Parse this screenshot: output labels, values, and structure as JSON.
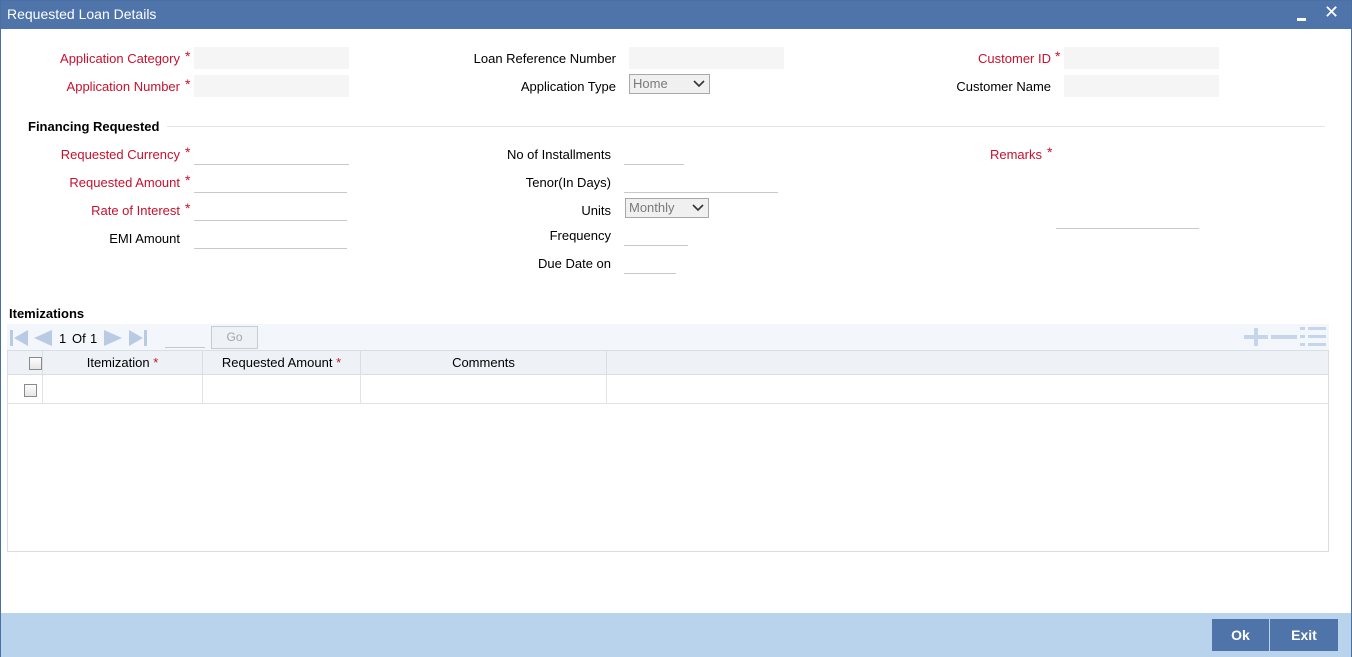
{
  "window": {
    "title": "Requested Loan Details"
  },
  "fields": {
    "application_category": {
      "label": "Application Category",
      "value": ""
    },
    "application_number": {
      "label": "Application Number",
      "value": ""
    },
    "loan_reference_number": {
      "label": "Loan Reference Number",
      "value": ""
    },
    "application_type": {
      "label": "Application Type",
      "selected": "Home"
    },
    "customer_id": {
      "label": "Customer ID",
      "value": ""
    },
    "customer_name": {
      "label": "Customer Name",
      "value": ""
    }
  },
  "financing": {
    "section_title": "Financing Requested",
    "requested_currency": {
      "label": "Requested Currency",
      "value": ""
    },
    "requested_amount": {
      "label": "Requested Amount",
      "value": ""
    },
    "rate_of_interest": {
      "label": "Rate of Interest",
      "value": ""
    },
    "emi_amount": {
      "label": "EMI Amount",
      "value": ""
    },
    "no_of_installments": {
      "label": "No of Installments",
      "value": ""
    },
    "tenor": {
      "label": "Tenor(In Days)",
      "value": ""
    },
    "units": {
      "label": "Units",
      "selected": "Monthly"
    },
    "frequency": {
      "label": "Frequency",
      "value": ""
    },
    "due_date_on": {
      "label": "Due Date on",
      "value": ""
    },
    "remarks": {
      "label": "Remarks",
      "value": ""
    }
  },
  "required_mark": "*",
  "itemizations": {
    "section_title": "Itemizations",
    "pagination": {
      "current": "1",
      "of_label": "Of",
      "total": "1",
      "go_label": "Go"
    },
    "columns": [
      "Itemization",
      "Requested Amount",
      "Comments"
    ],
    "rows": [
      {
        "itemization": "",
        "requested_amount": "",
        "comments": ""
      }
    ]
  },
  "footer": {
    "ok_label": "Ok",
    "exit_label": "Exit"
  },
  "colors": {
    "titlebar": "#4f74a9",
    "required": "#c8102e",
    "footer": "#b9d3ec",
    "button": "#4f74a9"
  }
}
